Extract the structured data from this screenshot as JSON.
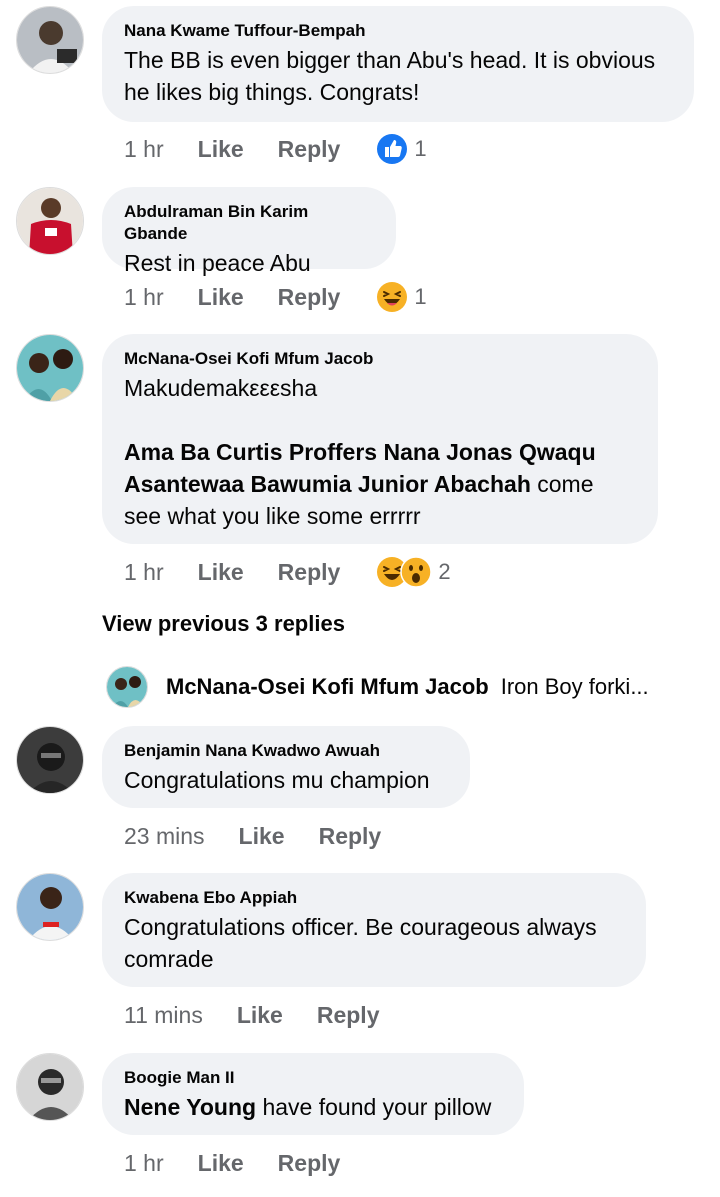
{
  "comments": [
    {
      "author": "Nana Kwame Tuffour-Bempah",
      "text": "The BB is even bigger than Abu's head. It is obvious he likes big things. Congrats!",
      "time": "1 hr",
      "like": "Like",
      "reply": "Reply",
      "reaction_icon": "thumbs-up-icon",
      "reaction_count": "1"
    },
    {
      "author": "Abdulraman Bin Karim Gbande",
      "text": "Rest in peace Abu",
      "time": "1 hr",
      "like": "Like",
      "reply": "Reply",
      "reaction_icon": "laughing-emoji-icon",
      "reaction_count": "1"
    },
    {
      "author": "McNana-Osei Kofi Mfum Jacob",
      "text": "Makudemakεεεsha",
      "mentions": "Ama Ba Curtis Proffers Nana Jonas Qwaqu Asantewaa Bawumia Junior Abachah",
      "text_after": "come see what you like some errrrr",
      "time": "1 hr",
      "like": "Like",
      "reply": "Reply",
      "reaction_icon": "laughing-wow-emoji-icon",
      "reaction_count": "2"
    },
    {
      "author": "Benjamin Nana Kwadwo Awuah",
      "text": "Congratulations mu champion",
      "time": "23 mins",
      "like": "Like",
      "reply": "Reply"
    },
    {
      "author": "Kwabena Ebo Appiah",
      "text": "Congratulations officer. Be courageous always comrade",
      "time": "11 mins",
      "like": "Like",
      "reply": "Reply"
    },
    {
      "author": "Boogie Man II",
      "mention": "Nene Young",
      "text": "have found your pillow",
      "time": "1 hr",
      "like": "Like",
      "reply": "Reply"
    }
  ],
  "view_previous": "View previous 3 replies",
  "collapsed_reply": {
    "author": "McNana-Osei Kofi Mfum Jacob",
    "text": "Iron Boy forki..."
  },
  "colors": {
    "bubble": "#f0f2f5",
    "meta_text": "#65676b",
    "like_blue": "#1877f2",
    "emoji_yellow": "#f7b125"
  }
}
